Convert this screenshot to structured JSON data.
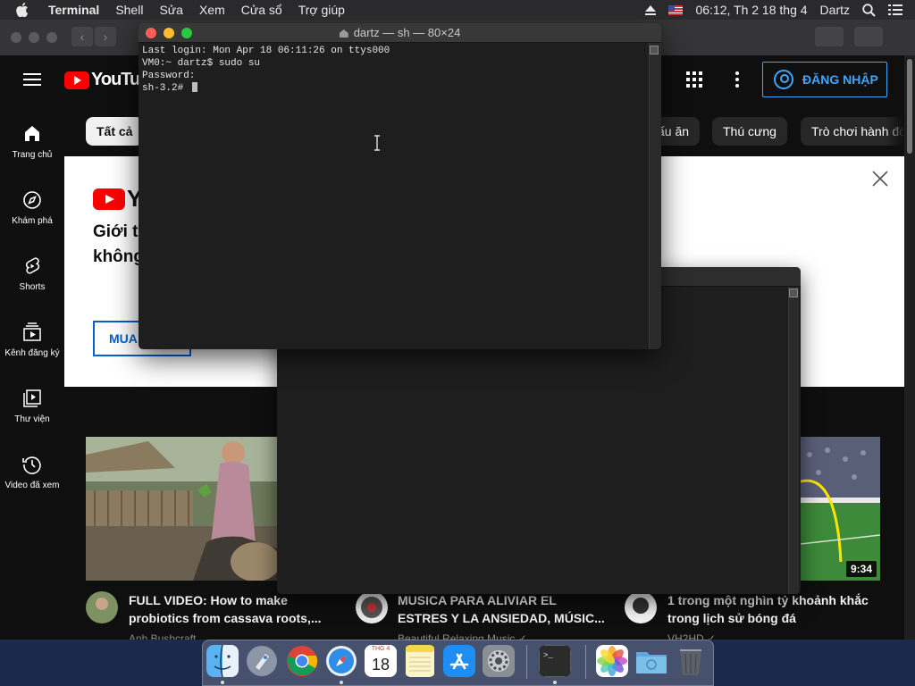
{
  "menubar": {
    "app_name": "Terminal",
    "items": [
      "Shell",
      "Sửa",
      "Xem",
      "Cửa sổ",
      "Trợ giúp"
    ],
    "clock": "06:12, Th 2 18 thg 4",
    "user": "Dartz"
  },
  "terminal": {
    "title": "dartz — sh — 80×24",
    "lines": [
      "Last login: Mon Apr 18 06:11:26 on ttys000",
      "VM0:~ dartz$ sudo su",
      "Password:",
      "sh-3.2# "
    ]
  },
  "youtube": {
    "logo_text": "YouTube",
    "signin_label": "ĐĂNG NHẬP",
    "sidebar": [
      {
        "label": "Trang chủ",
        "icon": "home-icon"
      },
      {
        "label": "Khám phá",
        "icon": "compass-icon"
      },
      {
        "label": "Shorts",
        "icon": "shorts-icon"
      },
      {
        "label": "Kênh đăng ký",
        "icon": "subscriptions-icon"
      },
      {
        "label": "Thư viện",
        "icon": "library-icon"
      },
      {
        "label": "Video đã xem",
        "icon": "history-icon"
      }
    ],
    "chips": [
      "Tất cả",
      "ấu ăn",
      "Thú cưng",
      "Trò chơi hành độ"
    ],
    "promo": {
      "logo_text": "Yo",
      "line1": "Giới t",
      "line2": "không",
      "button": "MUA"
    },
    "videos": [
      {
        "title_line1": "FULL VIDEO: How to make",
        "title_line2": "probiotics from cassava roots,...",
        "channel": "Anh Bushcraft"
      },
      {
        "title_line1": "MUSICA PARA ALIVIAR EL",
        "title_line2": "ESTRES Y LA ANSIEDAD, MÚSIC...",
        "channel": "Beautiful Relaxing Music ✓"
      },
      {
        "title_line1": "1 trong một nghìn tỷ khoảnh khắc",
        "title_line2": "trong lịch sử bóng đá",
        "channel": "VH2HD ✓",
        "duration": "9:34"
      }
    ]
  },
  "dock": {
    "calendar_month": "THG 4",
    "calendar_day": "18",
    "apps": [
      "Finder",
      "Launchpad",
      "Chrome",
      "Safari",
      "Calendar",
      "Notes",
      "App Store",
      "System Preferences",
      "Terminal",
      "Photos",
      "Downloads",
      "Trash"
    ]
  }
}
